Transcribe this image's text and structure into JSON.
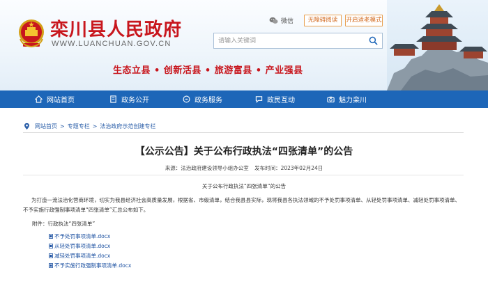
{
  "header": {
    "site_title": "栾川县人民政府",
    "site_url": "WWW.LUANCHUAN.GOV.CN",
    "wechat_label": "微信",
    "btn_accessible": "无障碍阅读",
    "btn_elderly": "开启适老模式",
    "search_placeholder": "请输入关键词",
    "slogan": "生态立县 • 创新活县 • 旅游富县 • 产业强县"
  },
  "nav": {
    "items": [
      {
        "label": "网站首页",
        "icon": "home-icon"
      },
      {
        "label": "政务公开",
        "icon": "document-icon"
      },
      {
        "label": "政务服务",
        "icon": "chat-icon"
      },
      {
        "label": "政民互动",
        "icon": "comment-icon"
      },
      {
        "label": "魅力栾川",
        "icon": "camera-icon"
      }
    ]
  },
  "breadcrumb": {
    "items": [
      "网站首页",
      "专题专栏",
      "法治政府示范创建专栏"
    ],
    "separator": ">"
  },
  "article": {
    "title": "【公示公告】关于公布行政执法“四张清单”的公告",
    "source_label": "来源：法治政府建设领导小组办公室",
    "date_label": "发布时间：2023年02月24日",
    "subhead": "关于公布行政执法“四张清单”的公告",
    "paragraph": "为打造一流法治化营商环境，切实为我县经济社会高质量发展，根据省、市级清单，结合我县县实际，现将我县各执法领域的不予处罚事项清单、从轻处罚事项清单、减轻处罚事项清单、不予实施行政强制事项清单“四张清单”汇总公布如下。",
    "attachment_label": "附件：行政执法“四张清单”",
    "files": [
      "不予处罚事项清单.docx",
      "从轻处罚事项清单.docx",
      "减轻处罚事项清单.docx",
      "不予实施行政强制事项清单.docx"
    ]
  },
  "colors": {
    "brand_red": "#c8161d",
    "nav_blue": "#1d66b8",
    "link_blue": "#1a4fa0",
    "button_orange": "#e8a04f"
  }
}
